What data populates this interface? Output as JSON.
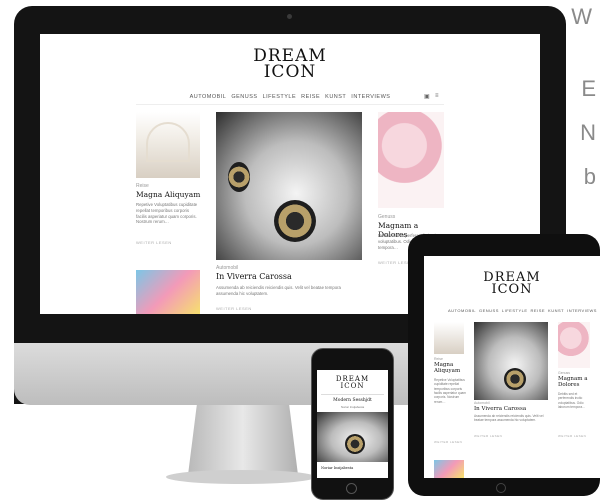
{
  "side_text": {
    "line1": "W",
    "line2": "E",
    "line3": "N",
    "line4": "b"
  },
  "site": {
    "logo_line1": "DREAM",
    "logo_line2": "ICON"
  },
  "menu": {
    "items": [
      "AUTOMOBIL",
      "GENUSS",
      "LIFESTYLE",
      "REISE",
      "KUNST",
      "INTERVIEWS"
    ]
  },
  "posts": {
    "left": {
      "tag": "Reise",
      "title": "Magna Aliquyam",
      "excerpt": "Repetive Voluptatibus cupiditate repellat temporibus corporis facilis asperiatur quam corporis. Nostrum rerum…",
      "more": "WEITER LESEN"
    },
    "center": {
      "tag": "Automobil",
      "title": "In Viverra Carossa",
      "excerpt": "Assumenda ab reiciendis reiciendis quis. Velit vel beatae tempora assumenda hic voluptatem.",
      "more": "WEITER LESEN"
    },
    "right": {
      "tag": "Genuss",
      "title": "Magnam a Dolores",
      "excerpt": "Debitis sed et perferendis inctio voluptatibus. Odio laborum tempora…",
      "more": "WEITER LESEN"
    }
  },
  "phone": {
    "title": "Modern Sesshjdt",
    "subtitle": "Noriar Insijabesta"
  }
}
